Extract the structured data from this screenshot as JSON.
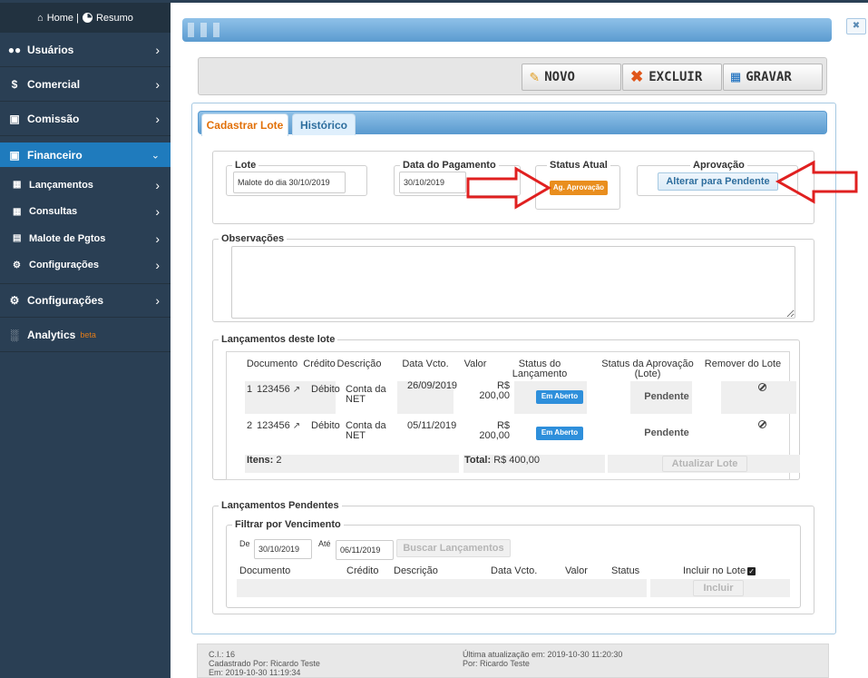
{
  "sidebar": {
    "top": {
      "home_label": "Home |",
      "resumo_label": "Resumo"
    },
    "items": [
      {
        "label": "Usuários"
      },
      {
        "label": "Comercial"
      },
      {
        "label": "Comissão"
      },
      {
        "label": "Financeiro"
      },
      {
        "label": "Configurações"
      },
      {
        "label": "Analytics",
        "badge": "beta"
      }
    ],
    "subitems": [
      {
        "label": "Lançamentos"
      },
      {
        "label": "Consultas"
      },
      {
        "label": "Malote de Pgtos"
      },
      {
        "label": "Configurações"
      }
    ]
  },
  "toolbar": {
    "novo_label": "NOVO",
    "excluir_label": "EXCLUIR",
    "gravar_label": "GRAVAR"
  },
  "tabs": [
    {
      "label": "Cadastrar Lote"
    },
    {
      "label": "Histórico"
    }
  ],
  "form": {
    "lote_legend": "Lote",
    "lote_value": "Malote do dia 30/10/2019",
    "data_legend": "Data do Pagamento",
    "data_value": "30/10/2019",
    "status_legend": "Status Atual",
    "status_value": "Ag. Aprovação",
    "aprovacao_legend": "Aprovação",
    "aprovacao_button": "Alterar para Pendente",
    "obs_legend": "Observações"
  },
  "lote_table": {
    "legend": "Lançamentos deste lote",
    "headers": [
      "Documento",
      "Crédito",
      "Descrição",
      "Data Vcto.",
      "Valor",
      "Status do Lançamento",
      "Status da Aprovação (Lote)",
      "Remover do Lote"
    ],
    "rows": [
      {
        "index": "1",
        "documento": "123456",
        "credito": "Débito",
        "descricao": "Conta da NET",
        "data": "26/09/2019",
        "valor": "R$ 200,00",
        "status": "Em Aberto",
        "aprovacao": "Pendente"
      },
      {
        "index": "2",
        "documento": "123456",
        "credito": "Débito",
        "descricao": "Conta da NET",
        "data": "05/11/2019",
        "valor": "R$ 200,00",
        "status": "Em Aberto",
        "aprovacao": "Pendente"
      }
    ],
    "itens_label": "Itens:",
    "itens_value": "2",
    "total_label": "Total:",
    "total_value": "R$ 400,00",
    "atualizar_button": "Atualizar Lote"
  },
  "pendentes": {
    "legend": "Lançamentos Pendentes",
    "filter_legend": "Filtrar por Vencimento",
    "de_label": "De",
    "de_value": "30/10/2019",
    "ate_label": "Até",
    "ate_value": "06/11/2019",
    "buscar_button": "Buscar Lançamentos",
    "headers": [
      "Documento",
      "Crédito",
      "Descrição",
      "Data Vcto.",
      "Valor",
      "Status",
      "Incluir no Lote"
    ],
    "incluir_button": "Incluir"
  },
  "footer": {
    "ci": "C.I.: 16",
    "cadastrado_por": "Cadastrado Por: Ricardo Teste",
    "em": "Em: 2019-10-30 11:19:34",
    "ultima_atualizacao": "Última atualização em: 2019-10-30 11:20:30",
    "por": "Por: Ricardo Teste"
  },
  "colors": {
    "sidebar_bg": "#2a3f54",
    "active_item": "#1f7bbd",
    "status_badge": "#e98e1e",
    "em_aberto": "#2e8fdb",
    "arrow": "#e02020"
  }
}
